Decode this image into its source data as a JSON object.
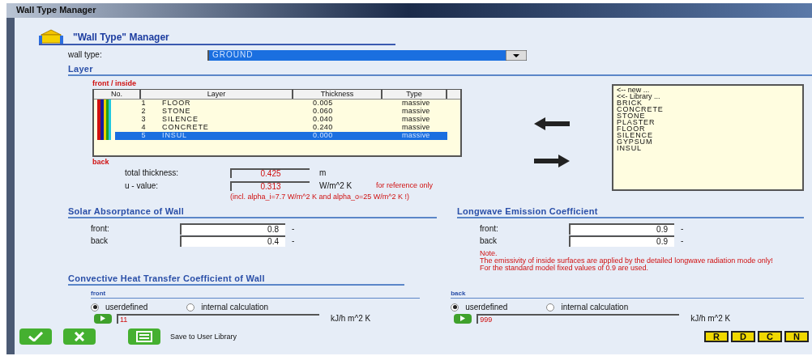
{
  "window": {
    "title": "Wall Type Manager"
  },
  "header": {
    "title": "\"Wall Type\" Manager"
  },
  "wall_type": {
    "label": "wall type:",
    "value": "GROUND"
  },
  "layer_section": {
    "title": "Layer",
    "front_label": "front / inside",
    "back_label": "back",
    "table": {
      "columns": [
        "No.",
        "Layer",
        "Thickness",
        "Type"
      ],
      "rows": [
        {
          "cells": [
            "1",
            "FLOOR",
            "0.005",
            "massive"
          ],
          "selected": false
        },
        {
          "cells": [
            "2",
            "STONE",
            "0.060",
            "massive"
          ],
          "selected": false
        },
        {
          "cells": [
            "3",
            "SILENCE",
            "0.040",
            "massive"
          ],
          "selected": false
        },
        {
          "cells": [
            "4",
            "CONCRETE",
            "0.240",
            "massive"
          ],
          "selected": false
        },
        {
          "cells": [
            "5",
            "INSUL",
            "0.000",
            "massive"
          ],
          "selected": true
        }
      ]
    },
    "library": {
      "items": [
        {
          "label": "<-- new ...",
          "kind": "action"
        },
        {
          "label": "<<- Library ...",
          "kind": "action"
        },
        {
          "label": "BRICK",
          "kind": "material"
        },
        {
          "label": "CONCRETE",
          "kind": "material"
        },
        {
          "label": "STONE",
          "kind": "material"
        },
        {
          "label": "PLASTER",
          "kind": "material"
        },
        {
          "label": "FLOOR",
          "kind": "material"
        },
        {
          "label": "SILENCE",
          "kind": "material"
        },
        {
          "label": "GYPSUM",
          "kind": "material"
        },
        {
          "label": "INSUL",
          "kind": "material"
        }
      ]
    },
    "total_thickness": {
      "label": "total thickness:",
      "value": "0.425",
      "unit": "m"
    },
    "u_value": {
      "label": "u - value:",
      "value": "0.313",
      "unit": "W/m^2 K",
      "remark": "for reference only"
    },
    "u_value_note": "(incl. alpha_i=7.7 W/m^2 K and alpha_o=25 W/m^2 K !)"
  },
  "solar": {
    "title": "Solar Absorptance of Wall",
    "fields": [
      {
        "label": "front:",
        "value": "0.8",
        "unit": "-"
      },
      {
        "label": "back",
        "value": "0.4",
        "unit": "-"
      }
    ]
  },
  "longwave": {
    "title": "Longwave Emission Coefficient",
    "fields": [
      {
        "label": "front:",
        "value": "0.9",
        "unit": "-"
      },
      {
        "label": "back",
        "value": "0.9",
        "unit": "-"
      }
    ],
    "note_title": "Note.",
    "note_lines": [
      "The emissivity of inside surfaces are applied by the detailed longwave radiation mode only!",
      "For the standard model fixed values of 0.9 are used."
    ]
  },
  "convective": {
    "title": "Convective Heat Transfer Coefficient of Wall",
    "sides": [
      {
        "label": "front",
        "options": [
          {
            "label": "userdefined",
            "selected": true
          },
          {
            "label": "internal calculation",
            "selected": false
          }
        ],
        "value": "11",
        "unit": "kJ/h m^2 K"
      },
      {
        "label": "back",
        "options": [
          {
            "label": "userdefined",
            "selected": true
          },
          {
            "label": "internal calculation",
            "selected": false
          }
        ],
        "value": "999",
        "unit": "kJ/h m^2 K"
      }
    ]
  },
  "footer": {
    "save_label": "Save to User Library",
    "letter_buttons": [
      "R",
      "D",
      "C",
      "N"
    ]
  }
}
